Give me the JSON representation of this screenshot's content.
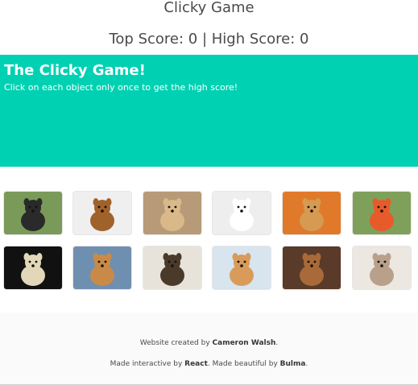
{
  "navbar": {
    "title": "Clicky Game",
    "score_text": "Top Score: 0 | High Score: 0"
  },
  "hero": {
    "heading": "The Clicky Game!",
    "subtitle": "Click on each object only once to get the high score!"
  },
  "tiles": [
    {
      "name": "tile-french-bulldog",
      "bg": "#7a9a5a",
      "subject": "#2a2a2a"
    },
    {
      "name": "tile-dog-lion-costume",
      "bg": "#efefef",
      "subject": "#a0622b"
    },
    {
      "name": "tile-pug",
      "bg": "#b79a78",
      "subject": "#d9b98a"
    },
    {
      "name": "tile-dalmatian",
      "bg": "#eeeeee",
      "subject": "#ffffff"
    },
    {
      "name": "tile-chihuahua",
      "bg": "#e07a2a",
      "subject": "#d69a52"
    },
    {
      "name": "tile-puppy-in-cup",
      "bg": "#7fa05a",
      "subject": "#e75a2a"
    },
    {
      "name": "tile-labrador",
      "bg": "#111111",
      "subject": "#e2d7b8"
    },
    {
      "name": "tile-corgi",
      "bg": "#6f8fb0",
      "subject": "#c98a48"
    },
    {
      "name": "tile-dog-teacup",
      "bg": "#e8e3da",
      "subject": "#4a3a2a"
    },
    {
      "name": "tile-pomeranian-toast",
      "bg": "#d8e4ee",
      "subject": "#d99b5a"
    },
    {
      "name": "tile-gingerbread-dog",
      "bg": "#5a3a28",
      "subject": "#a86a38"
    },
    {
      "name": "tile-shih-tzu",
      "bg": "#ece7e1",
      "subject": "#b9a08a"
    }
  ],
  "footer": {
    "created_prefix": "Website created by ",
    "author": "Cameron Walsh",
    "created_suffix": ".",
    "made_prefix": "Made interactive by ",
    "react": "React",
    "made_middle": ". Made beautiful by ",
    "bulma": "Bulma",
    "made_suffix": "."
  }
}
